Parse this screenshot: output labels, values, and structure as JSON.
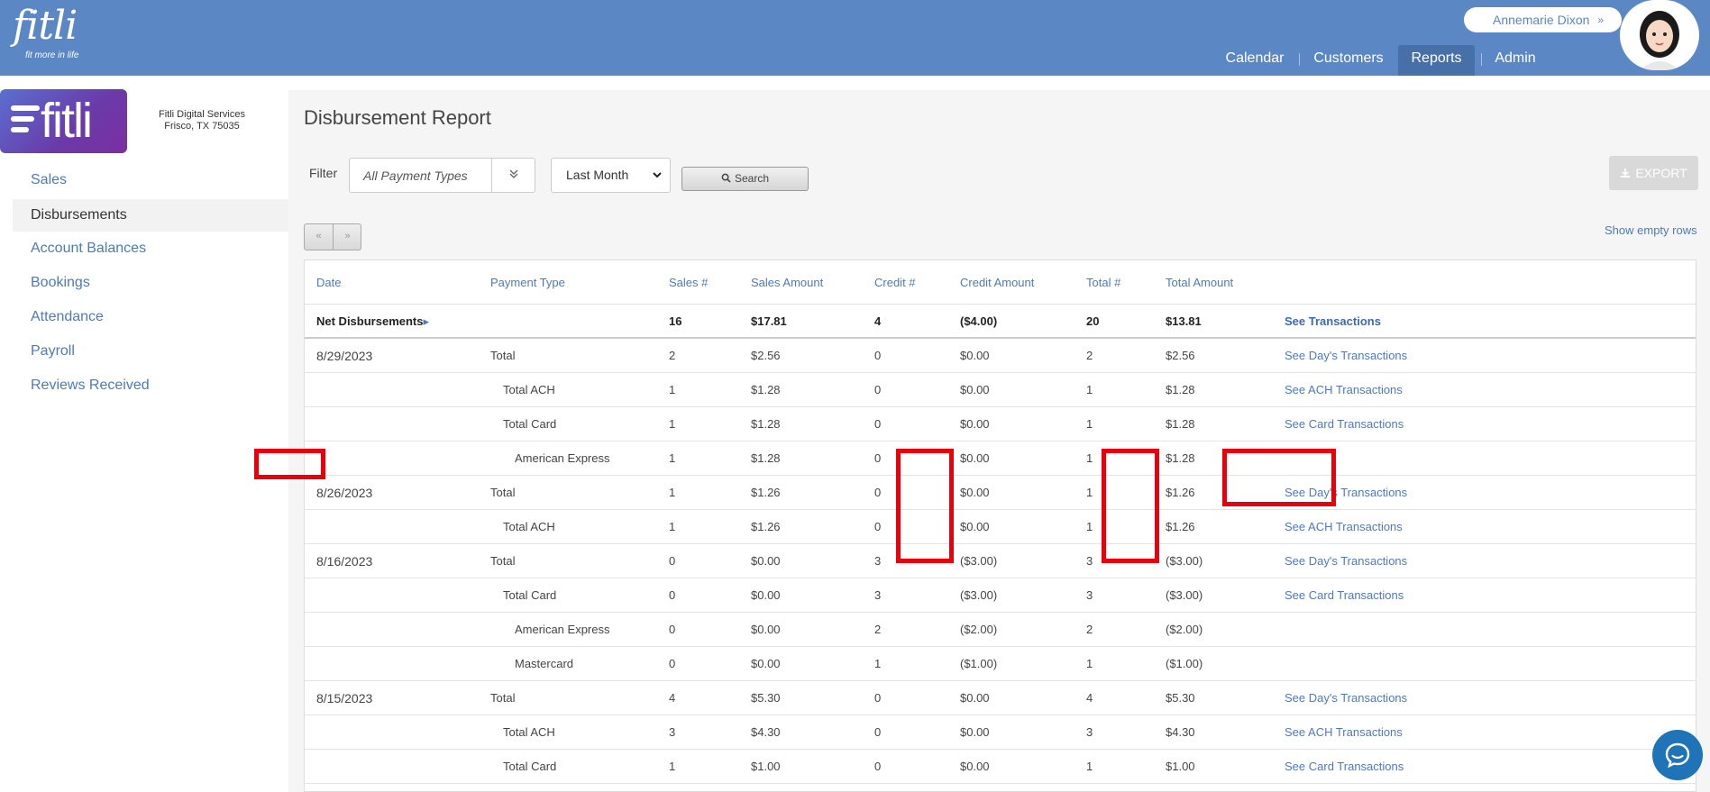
{
  "app": {
    "logo_text": "fitli",
    "logo_tagline": "fit more in life",
    "user_name": "Annemarie Dixon",
    "user_chevron": "»",
    "icons": [
      "user-chevron-icon",
      "avatar-icon",
      "filter-chevron-icon",
      "search-icon",
      "download-icon",
      "chat-icon"
    ]
  },
  "nav": {
    "items": [
      {
        "label": "Calendar",
        "active": false
      },
      {
        "label": "Customers",
        "active": false
      },
      {
        "label": "Reports",
        "active": true
      },
      {
        "label": "Admin",
        "active": false
      }
    ]
  },
  "sidebar": {
    "brand": "fitli",
    "company_name": "Fitli Digital Services",
    "company_location": "Frisco, TX 75035",
    "items": [
      {
        "label": "Sales",
        "active": false
      },
      {
        "label": "Disbursements",
        "active": true
      },
      {
        "label": "Account Balances",
        "active": false
      },
      {
        "label": "Bookings",
        "active": false
      },
      {
        "label": "Attendance",
        "active": false
      },
      {
        "label": "Payroll",
        "active": false
      },
      {
        "label": "Reviews Received",
        "active": false
      }
    ]
  },
  "report": {
    "title": "Disbursement Report",
    "filter_label": "Filter",
    "payment_type_placeholder": "All Payment Types",
    "period_value": "Last Month",
    "search_label": "Search",
    "export_label": "EXPORT",
    "pager_prev": "«",
    "pager_next": "»",
    "show_empty_label": "Show empty rows"
  },
  "table": {
    "headers": [
      "Date",
      "Payment Type",
      "Sales #",
      "Sales Amount",
      "Credit #",
      "Credit Amount",
      "Total #",
      "Total Amount",
      ""
    ],
    "net": {
      "label": "Net Disbursements",
      "arrow": "▸",
      "sales_count": "16",
      "sales_amount": "$17.81",
      "credit_count": "4",
      "credit_amount": "($4.00)",
      "total_count": "20",
      "total_amount": "$13.81",
      "link": "See Transactions"
    },
    "rows": [
      {
        "date": "8/29/2023",
        "type": "Total",
        "indent": 0,
        "sales_count": "2",
        "sales_amount": "$2.56",
        "credit_count": "0",
        "credit_amount": "$0.00",
        "total_count": "2",
        "total_amount": "$2.56",
        "link": "See Day's Transactions"
      },
      {
        "date": "",
        "type": "Total ACH",
        "indent": 1,
        "sales_count": "1",
        "sales_amount": "$1.28",
        "credit_count": "0",
        "credit_amount": "$0.00",
        "total_count": "1",
        "total_amount": "$1.28",
        "link": "See ACH Transactions"
      },
      {
        "date": "",
        "type": "Total Card",
        "indent": 1,
        "sales_count": "1",
        "sales_amount": "$1.28",
        "credit_count": "0",
        "credit_amount": "$0.00",
        "total_count": "1",
        "total_amount": "$1.28",
        "link": "See Card Transactions"
      },
      {
        "date": "",
        "type": "American Express",
        "indent": 2,
        "sales_count": "1",
        "sales_amount": "$1.28",
        "credit_count": "0",
        "credit_amount": "$0.00",
        "total_count": "1",
        "total_amount": "$1.28",
        "link": ""
      },
      {
        "date": "8/26/2023",
        "type": "Total",
        "indent": 0,
        "sales_count": "1",
        "sales_amount": "$1.26",
        "credit_count": "0",
        "credit_amount": "$0.00",
        "total_count": "1",
        "total_amount": "$1.26",
        "link": "See Day's Transactions"
      },
      {
        "date": "",
        "type": "Total ACH",
        "indent": 1,
        "sales_count": "1",
        "sales_amount": "$1.26",
        "credit_count": "0",
        "credit_amount": "$0.00",
        "total_count": "1",
        "total_amount": "$1.26",
        "link": "See ACH Transactions"
      },
      {
        "date": "8/16/2023",
        "type": "Total",
        "indent": 0,
        "sales_count": "0",
        "sales_amount": "$0.00",
        "credit_count": "3",
        "credit_amount": "($3.00)",
        "total_count": "3",
        "total_amount": "($3.00)",
        "link": "See Day's Transactions"
      },
      {
        "date": "",
        "type": "Total Card",
        "indent": 1,
        "sales_count": "0",
        "sales_amount": "$0.00",
        "credit_count": "3",
        "credit_amount": "($3.00)",
        "total_count": "3",
        "total_amount": "($3.00)",
        "link": "See Card Transactions"
      },
      {
        "date": "",
        "type": "American Express",
        "indent": 2,
        "sales_count": "0",
        "sales_amount": "$0.00",
        "credit_count": "2",
        "credit_amount": "($2.00)",
        "total_count": "2",
        "total_amount": "($2.00)",
        "link": ""
      },
      {
        "date": "",
        "type": "Mastercard",
        "indent": 2,
        "sales_count": "0",
        "sales_amount": "$0.00",
        "credit_count": "1",
        "credit_amount": "($1.00)",
        "total_count": "1",
        "total_amount": "($1.00)",
        "link": ""
      },
      {
        "date": "8/15/2023",
        "type": "Total",
        "indent": 0,
        "sales_count": "4",
        "sales_amount": "$5.30",
        "credit_count": "0",
        "credit_amount": "$0.00",
        "total_count": "4",
        "total_amount": "$5.30",
        "link": "See Day's Transactions"
      },
      {
        "date": "",
        "type": "Total ACH",
        "indent": 1,
        "sales_count": "3",
        "sales_amount": "$4.30",
        "credit_count": "0",
        "credit_amount": "$0.00",
        "total_count": "3",
        "total_amount": "$4.30",
        "link": "See ACH Transactions"
      },
      {
        "date": "",
        "type": "Total Card",
        "indent": 1,
        "sales_count": "1",
        "sales_amount": "$1.00",
        "credit_count": "0",
        "credit_amount": "$0.00",
        "total_count": "1",
        "total_amount": "$1.00",
        "link": "See Card Transactions"
      }
    ]
  },
  "colors": {
    "header_blue": "#5b87c5",
    "link_blue": "#4e7ab8",
    "highlight_red": "#e8000a"
  }
}
